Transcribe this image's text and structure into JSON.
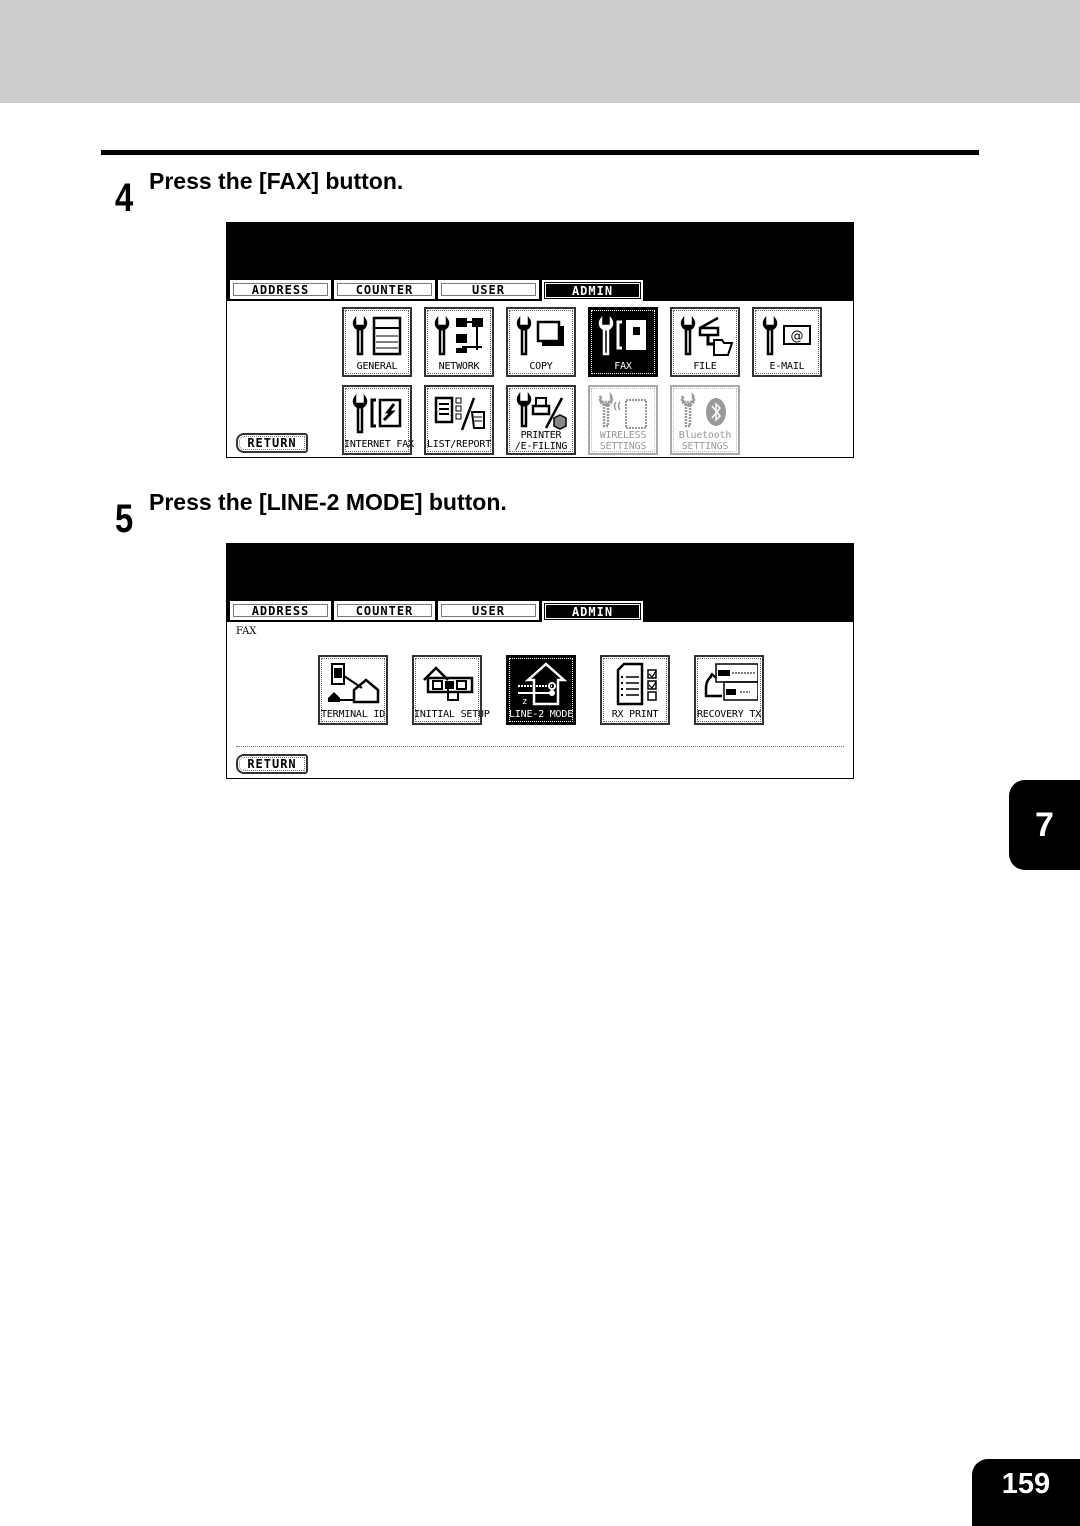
{
  "steps": [
    {
      "number": "4",
      "title": "Press the [FAX] button.",
      "screen": {
        "tabs": [
          {
            "label": "ADDRESS",
            "active": false
          },
          {
            "label": "COUNTER",
            "active": false
          },
          {
            "label": "USER",
            "active": false
          },
          {
            "label": "ADMIN",
            "active": true
          }
        ],
        "buttons": [
          {
            "label": "GENERAL",
            "icon": "wrench-copier-icon",
            "state": "normal"
          },
          {
            "label": "NETWORK",
            "icon": "wrench-network-icon",
            "state": "normal"
          },
          {
            "label": "COPY",
            "icon": "wrench-copy-icon",
            "state": "normal"
          },
          {
            "label": "FAX",
            "icon": "wrench-fax-icon",
            "state": "selected"
          },
          {
            "label": "FILE",
            "icon": "wrench-file-icon",
            "state": "normal"
          },
          {
            "label": "E-MAIL",
            "icon": "wrench-email-icon",
            "state": "normal"
          },
          {
            "label": "INTERNET FAX",
            "icon": "wrench-internet-fax-icon",
            "state": "normal"
          },
          {
            "label": "LIST/REPORT",
            "icon": "list-report-icon",
            "state": "normal"
          },
          {
            "label_line1": "PRINTER",
            "label_line2": "/E-FILING",
            "icon": "wrench-printer-efiling-icon",
            "state": "normal"
          },
          {
            "label_line1": "WIRELESS",
            "label_line2": "SETTINGS",
            "icon": "wrench-wireless-icon",
            "state": "disabled"
          },
          {
            "label_line1": "Bluetooth",
            "label_line2": "SETTINGS",
            "icon": "wrench-bluetooth-icon",
            "state": "disabled"
          }
        ],
        "return_label": "RETURN"
      }
    },
    {
      "number": "5",
      "title": "Press the [LINE-2 MODE] button.",
      "screen": {
        "tabs": [
          {
            "label": "ADDRESS",
            "active": false
          },
          {
            "label": "COUNTER",
            "active": false
          },
          {
            "label": "USER",
            "active": false
          },
          {
            "label": "ADMIN",
            "active": true
          }
        ],
        "breadcrumb": "FAX",
        "buttons": [
          {
            "label": "TERMINAL  ID",
            "icon": "terminal-id-icon",
            "state": "normal"
          },
          {
            "label": "INITIAL SETUP",
            "icon": "initial-setup-icon",
            "state": "normal"
          },
          {
            "label": "LINE-2 MODE",
            "icon": "line2-mode-icon",
            "state": "selected"
          },
          {
            "label": "RX PRINT",
            "icon": "rx-print-icon",
            "state": "normal"
          },
          {
            "label": "RECOVERY TX",
            "icon": "recovery-tx-icon",
            "state": "normal"
          }
        ],
        "return_label": "RETURN"
      }
    }
  ],
  "chapter_tab": "7",
  "page_number": "159"
}
